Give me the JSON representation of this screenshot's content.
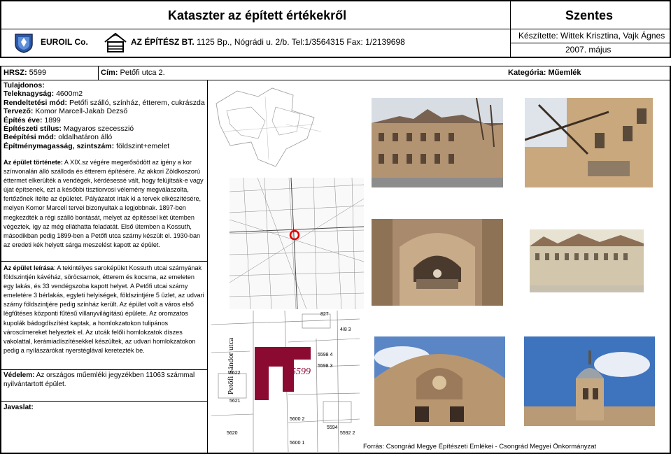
{
  "header": {
    "title": "Kataszter az épített értékekről",
    "city": "Szentes",
    "company1": "EUROIL Co.",
    "company2_name": "AZ ÉPÍTÉSZ BT.",
    "company2_address": "1125 Bp., Nógrádi u. 2/b. Tel:1/3564315 Fax: 1/2139698",
    "prepared_by": "Készítette: Wittek Krisztina, Vajk Ágnes",
    "date": "2007. május"
  },
  "record": {
    "hrsz_label": "HRSZ:",
    "hrsz_value": "5599",
    "address_label": "Cím:",
    "address_value": "Petőfi utca 2.",
    "category_label": "Kategória:",
    "category_value": "Műemlék"
  },
  "fields": [
    {
      "label": "Tulajdonos:",
      "value": ""
    },
    {
      "label": "Teleknagyság:",
      "value": "4600m2"
    },
    {
      "label": "Rendeltetési mód:",
      "value": "Petőfi szálló, színház, étterem, cukrászda"
    },
    {
      "label": "Tervező:",
      "value": "Komor Marcell-Jakab Dezső"
    },
    {
      "label": "Építés éve:",
      "value": "1899"
    },
    {
      "label": "Építészeti stílus:",
      "value": "Magyaros szecesszió"
    },
    {
      "label": "Beépítési mód:",
      "value": "oldalhatáron álló"
    },
    {
      "label": "Építménymagasság, szintszám:",
      "value": "földszint+emelet"
    }
  ],
  "history": {
    "label": "Az épület története:",
    "text": "A XIX.sz végére megerősödött az igény a kor színvonalán álló szálloda és étterem építésére. Az akkori Zöldkoszorú éttermet elkerülték a vendégek, kérdésessé vált, hogy felújítsák-e vagy újat építsenek, ezt a későbbi tisztiorvosi vélemény megválaszolta, fertőzőnek ítélte az épületet. Pályázatot írtak ki a tervek elkészítésére, melyen Komor Marcell tervei bizonyultak a legjobbnak. 1897-ben megkezdték a régi szálló bontását, melyet az építéssel két ütemben végeztek, így az még elláthatta feladatát. Első ütemben a Kossuth, másodikban pedig 1899-ben a Petőfi utca szárny készült el. 1930-ban az eredeti kék helyett sárga meszelést kapott az épület."
  },
  "description": {
    "label": "Az épület leírása",
    "text": ": A tekintélyes saroképület Kossuth utcai szárnyának földszintjén kávéház, söröcsarnok, étterem és kocsma, az emeleten egy lakás, és 33 vendégszoba kapott helyet. A Petőfi utcai szárny emeletére 3 bérlakás, egyleti helyiségek, földszintjére 5 üzlet, az udvari szárny földszintjére pedig színház került. Az épület volt a város első légfűtéses központi fűtésű villanyvilágítású épülete. Az oromzatos kupolák bádogdíszítést kaptak, a homlokzatokon tulipános városcímereket helyeztek el. Az utcák felőli homlokzatok díszes vakolattal, kerámiadíszítésekkel készültek, az udvari homlokzatokon pedig a nyílászárókat nyerstéglával keretezték be."
  },
  "protection": {
    "label": "Védelem:",
    "text": " Az országos műemléki jegyzékben 11063 számmal nyilvántartott épület."
  },
  "proposal": {
    "label": "Javaslat:"
  },
  "map_labels": {
    "street": "Petőfi Sándor utca",
    "parcel": "5599",
    "n1": "5622",
    "n2": "5621",
    "n3": "5620",
    "n4": "5600 1",
    "n5": "5600 2",
    "n6": "5598 4",
    "n7": "5598 3",
    "n8": "827",
    "n9": "5592 2",
    "n10": "5594",
    "n11": "4/8 3"
  },
  "source": "Forrás: Csongrád Megye Építészeti Emlékei - Csongrád Megyei Önkormányzat",
  "colors": {
    "parcel": "#8b0a32",
    "marker": "#e00000"
  }
}
